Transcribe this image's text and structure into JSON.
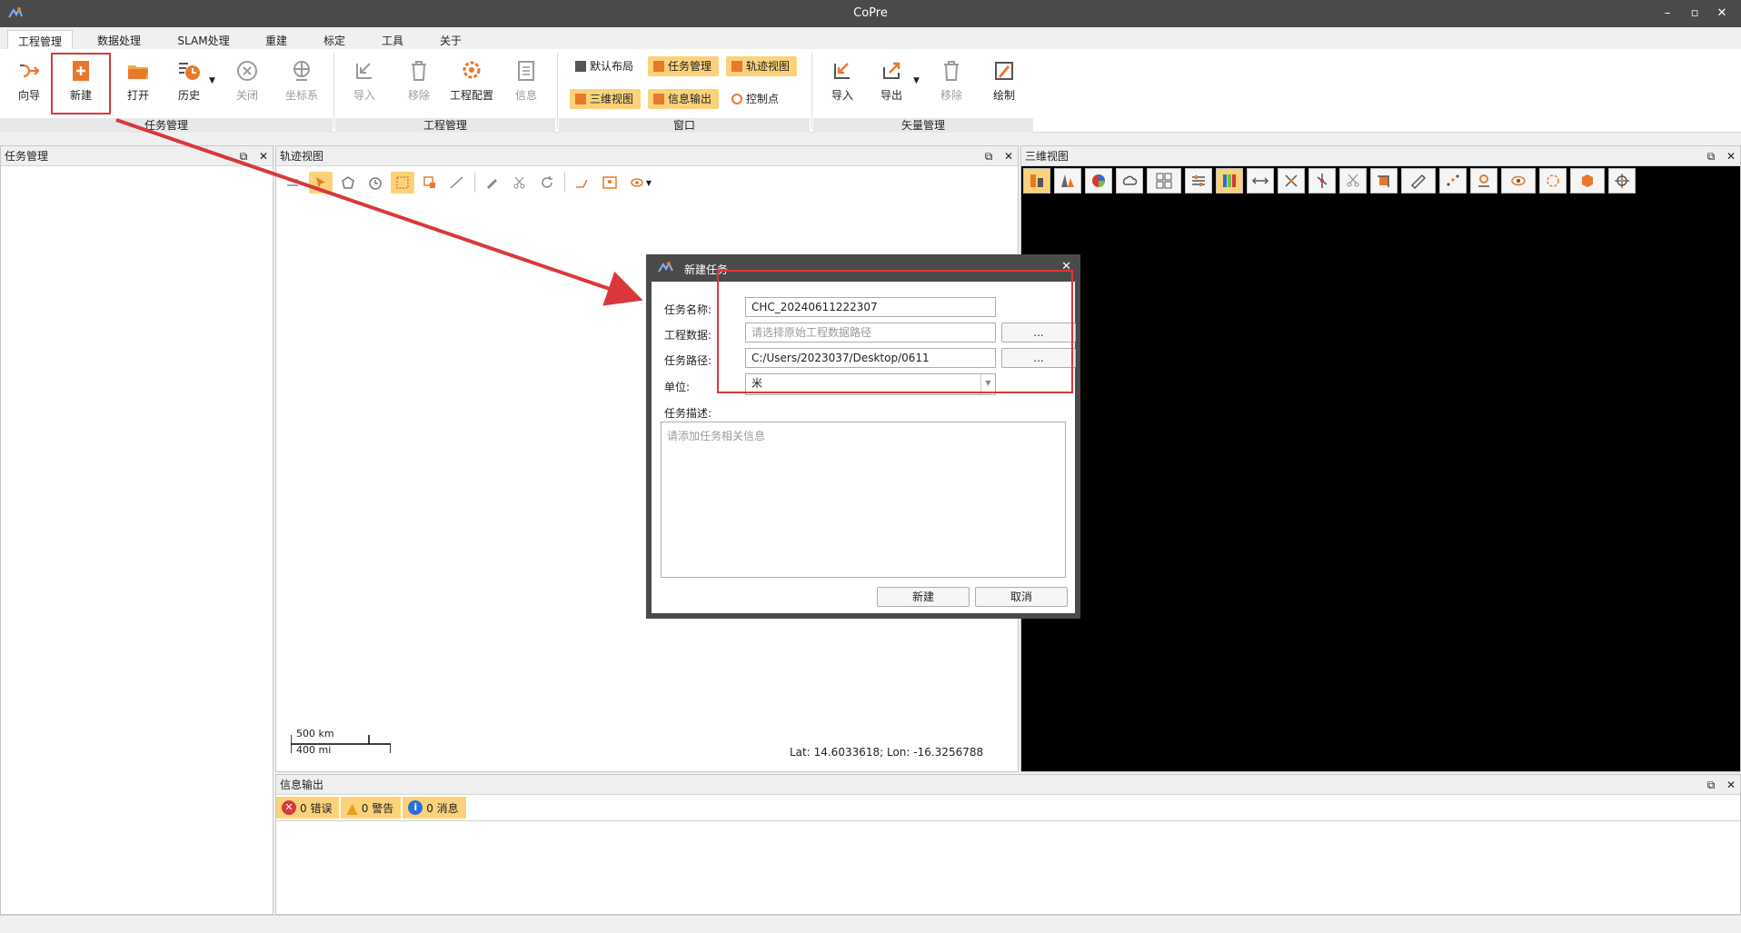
{
  "window": {
    "title": "CoPre",
    "min": "–",
    "max": "▫",
    "close": "✕"
  },
  "menu": {
    "tabs": [
      "工程管理",
      "数据处理",
      "SLAM处理",
      "重建",
      "标定",
      "工具",
      "关于"
    ]
  },
  "ribbon": {
    "task_group": {
      "label": "任务管理",
      "buttons": [
        "向导",
        "新建",
        "打开",
        "历史",
        "关闭",
        "坐标系"
      ]
    },
    "project_group": {
      "label": "工程管理",
      "buttons": [
        "导入",
        "移除",
        "工程配置",
        "信息"
      ]
    },
    "window_group": {
      "label": "窗口",
      "buttons": [
        "默认布局",
        "任务管理",
        "轨迹视图",
        "三维视图",
        "信息输出",
        "控制点"
      ]
    },
    "vector_group": {
      "label": "矢量管理",
      "buttons": [
        "导入",
        "导出",
        "移除",
        "绘制"
      ]
    }
  },
  "panels": {
    "task": {
      "title": "任务管理"
    },
    "track": {
      "title": "轨迹视图"
    },
    "view3d": {
      "title": "三维视图"
    },
    "info": {
      "title": "信息输出"
    },
    "float_icon": "⧉",
    "close_icon": "✕"
  },
  "track_view": {
    "scale_km": "500 km",
    "scale_mi": "400 mi",
    "coords": "Lat: 14.6033618; Lon: -16.3256788"
  },
  "info_tabs": {
    "errors": "0 错误",
    "warnings": "0 警告",
    "messages": "0 消息"
  },
  "dialog": {
    "title": "新建任务",
    "close": "✕",
    "task_name_label": "任务名称:",
    "task_name_value": "CHC_20240611222307",
    "project_data_label": "工程数据:",
    "project_data_placeholder": "请选择原始工程数据路径",
    "task_path_label": "任务路径:",
    "task_path_value": "C:/Users/2023037/Desktop/0611",
    "browse": "...",
    "unit_label": "单位:",
    "unit_value": "米",
    "desc_label": "任务描述:",
    "desc_placeholder": "请添加任务相关信息",
    "create_button": "新建",
    "cancel_button": "取消"
  },
  "colors": {
    "highlight": "#fbd27a",
    "annotation_red": "#d9383a",
    "titlebar": "#4a4a4a",
    "accent_orange": "#e8782a"
  }
}
